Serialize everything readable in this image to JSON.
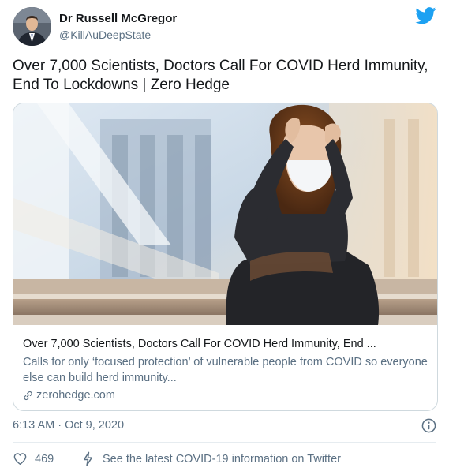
{
  "author": {
    "name": "Dr Russell McGregor",
    "handle": "@KillAuDeepState"
  },
  "tweet": {
    "text": "Over 7,000 Scientists, Doctors Call For COVID Herd Immunity, End To Lockdowns | Zero Hedge",
    "timestamp": "6:13 AM · Oct 9, 2020"
  },
  "card": {
    "title": "Over 7,000 Scientists, Doctors Call For COVID Herd Immunity, End ...",
    "description": "Calls for only  ‘focused protection’  of vulnerable people from COVID so everyone else can build herd immunity...",
    "domain": "zerohedge.com"
  },
  "actions": {
    "like_count": "469",
    "covid_info": "See the latest COVID-19 information on Twitter"
  },
  "colors": {
    "twitter_blue": "#1da1f2",
    "secondary_text": "#5b7083",
    "primary_text": "#14171a",
    "border": "#cfd9de"
  },
  "icons": [
    "twitter-bird-icon",
    "link-icon",
    "info-icon",
    "heart-icon",
    "lightning-bolt-icon"
  ]
}
